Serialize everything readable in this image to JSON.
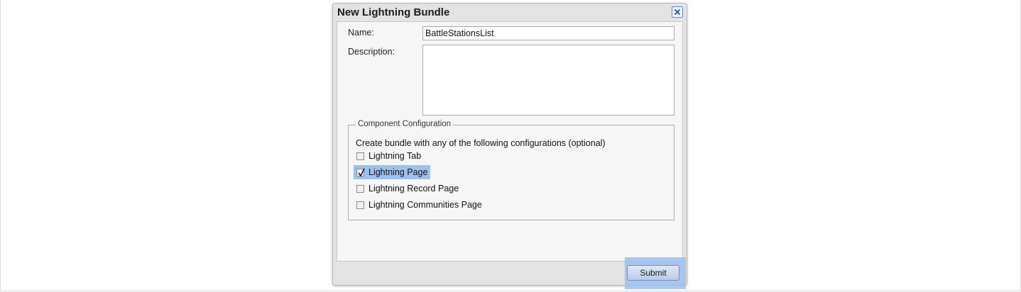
{
  "dialog": {
    "title": "New Lightning Bundle",
    "close_icon": "close-icon",
    "accent_color": "#5b86c5"
  },
  "form": {
    "name_label": "Name:",
    "name_value": "BattleStationsList",
    "description_label": "Description:",
    "description_value": ""
  },
  "component_config": {
    "legend": "Component Configuration",
    "intro": "Create bundle with any of the following configurations (optional)",
    "options": [
      {
        "label": "Lightning Tab",
        "checked": false
      },
      {
        "label": "Lightning Page",
        "checked": true
      },
      {
        "label": "Lightning Record Page",
        "checked": false
      },
      {
        "label": "Lightning Communities Page",
        "checked": false
      }
    ],
    "highlight_color": "#9dc0ef"
  },
  "footer": {
    "submit_label": "Submit"
  }
}
